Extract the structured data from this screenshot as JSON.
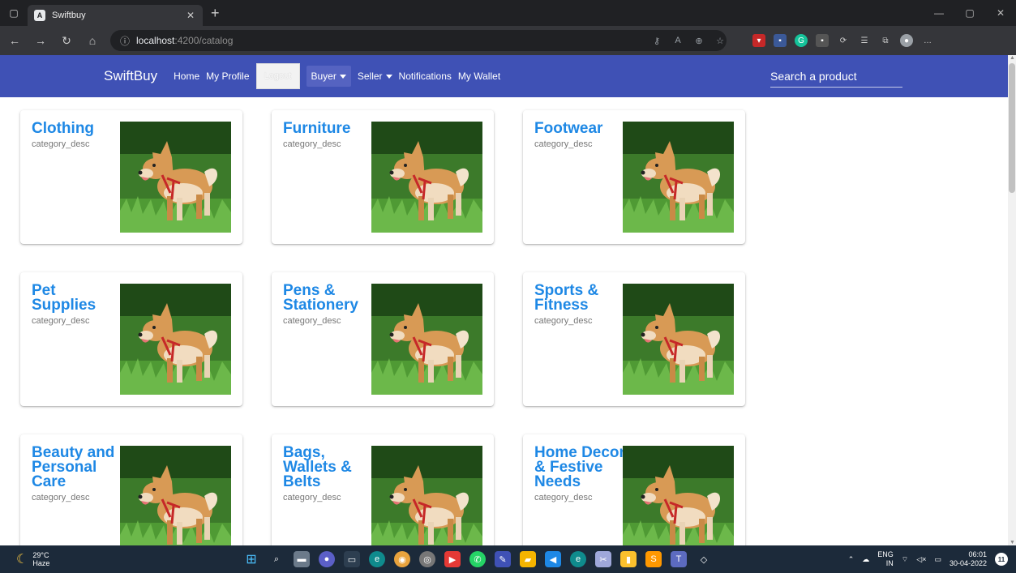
{
  "browser": {
    "tab_title": "Swiftbuy",
    "tab_favicon": "A",
    "url_host": "localhost",
    "url_rest": ":4200/catalog"
  },
  "navbar": {
    "brand": "SwiftBuy",
    "links": [
      "Home",
      "My Profile"
    ],
    "logout": "Logout",
    "buyer": "Buyer",
    "seller": "Seller",
    "notifications": "Notifications",
    "wallet": "My Wallet",
    "search_placeholder": "Search a product",
    "color": "#3f51b5"
  },
  "categories": [
    {
      "name": "Clothing",
      "desc": "category_desc"
    },
    {
      "name": "Furniture",
      "desc": "category_desc"
    },
    {
      "name": "Footwear",
      "desc": "category_desc"
    },
    {
      "name": "Pet Supplies",
      "desc": "category_desc"
    },
    {
      "name": "Pens & Stationery",
      "desc": "category_desc"
    },
    {
      "name": "Sports & Fitness",
      "desc": "category_desc"
    },
    {
      "name": "Beauty and Personal Care",
      "desc": "category_desc"
    },
    {
      "name": "Bags, Wallets & Belts",
      "desc": "category_desc"
    },
    {
      "name": "Home Decor & Festive Needs",
      "desc": "category_desc"
    }
  ],
  "taskbar": {
    "temp": "29°C",
    "weather": "Haze",
    "lang1": "ENG",
    "lang2": "IN",
    "time": "06:01",
    "date": "30-04-2022",
    "notifications": "11"
  }
}
